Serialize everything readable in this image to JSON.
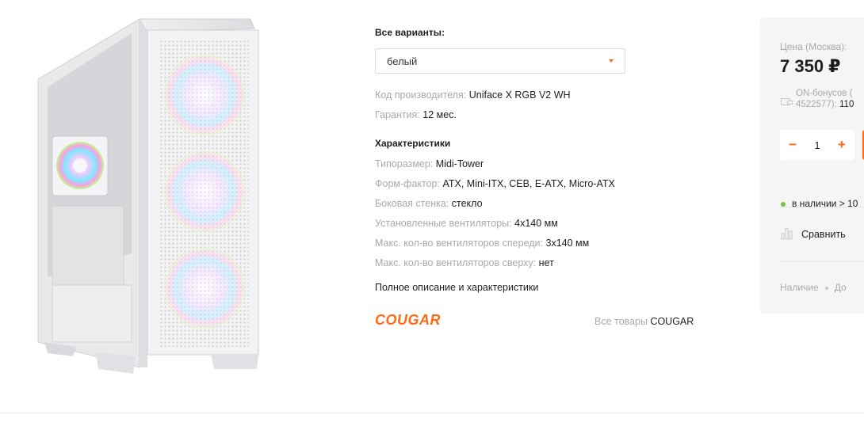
{
  "variants": {
    "title": "Все варианты:",
    "selected": "белый"
  },
  "details": {
    "vendor_code_label": "Код производителя:",
    "vendor_code": "Uniface X RGB V2 WH",
    "warranty_label": "Гарантия:",
    "warranty": "12 мес."
  },
  "specs": {
    "title": "Характеристики",
    "items": [
      {
        "k": "Типоразмер:",
        "v": "Midi-Tower"
      },
      {
        "k": "Форм-фактор:",
        "v": "ATX, Mini-ITX, CEB, E-ATX, Micro-ATX"
      },
      {
        "k": "Боковая стенка:",
        "v": "стекло"
      },
      {
        "k": "Установленные вентиляторы:",
        "v": "4x140 мм"
      },
      {
        "k": "Макс. кол-во вентиляторов спереди:",
        "v": "3x140 мм"
      },
      {
        "k": "Макс. кол-во вентиляторов сверху:",
        "v": "нет"
      }
    ],
    "full_link": "Полное описание и характеристики"
  },
  "brand": {
    "logo_text": "COUGAR",
    "all_goods_label": "Все товары",
    "all_goods_brand": "COUGAR",
    "color": "#ff6a13"
  },
  "buy": {
    "price_label": "Цена (Москва):",
    "price": "7 350 ₽",
    "bonus_line1": "ON-бонусов (",
    "bonus_line2_prefix": "4522577):",
    "bonus_value": "110",
    "qty_minus": "−",
    "qty_value": "1",
    "qty_plus": "+",
    "stock": "в наличии > 10",
    "compare": "Сравнить",
    "availability": "Наличие",
    "delivery": "До"
  },
  "colors": {
    "accent": "#ff6a13",
    "in_stock": "#7ac142",
    "muted": "#a9a9a9"
  }
}
